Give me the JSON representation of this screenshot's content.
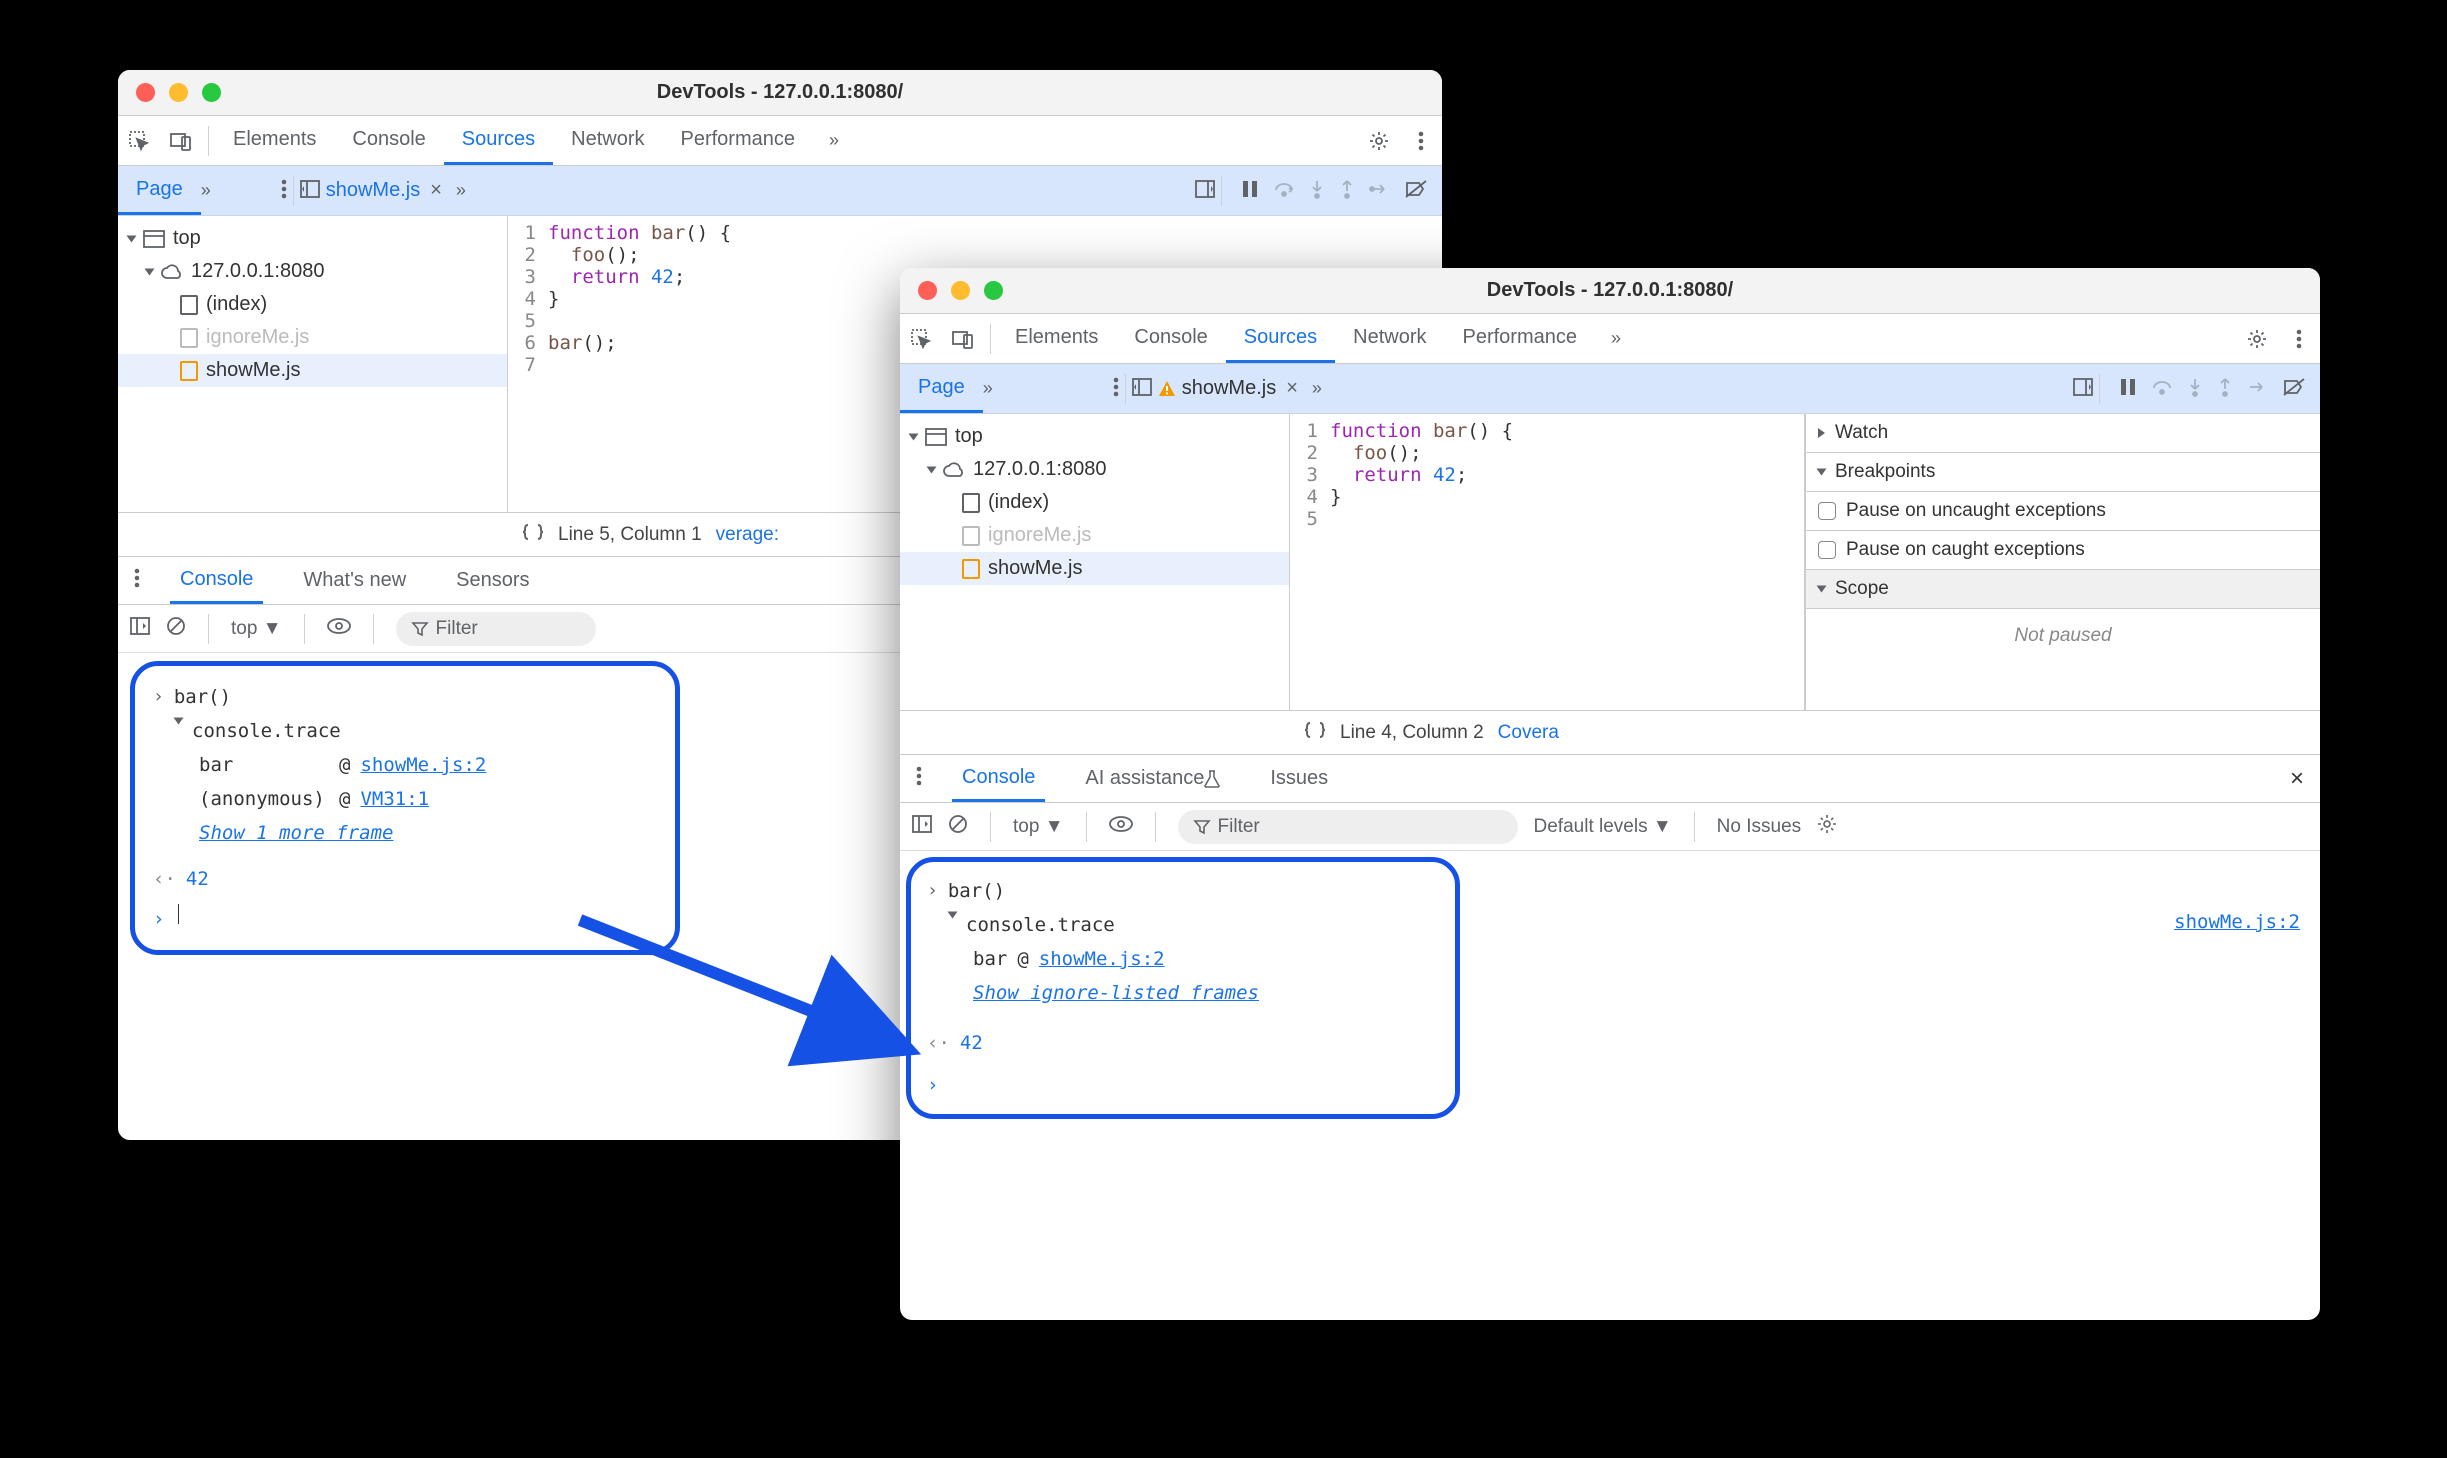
{
  "window1": {
    "title": "DevTools - 127.0.0.1:8080/",
    "mainTabs": [
      "Elements",
      "Console",
      "Sources",
      "Network",
      "Performance"
    ],
    "activeTab": "Sources",
    "page": {
      "tab": "Page",
      "openFile": "showMe.js"
    },
    "tree": {
      "top": "top",
      "host": "127.0.0.1:8080",
      "files": [
        "(index)",
        "ignoreMe.js",
        "showMe.js"
      ]
    },
    "code": [
      {
        "n": "1",
        "t": "function bar() {"
      },
      {
        "n": "2",
        "t": "  foo();"
      },
      {
        "n": "3",
        "t": "  return 42;"
      },
      {
        "n": "4",
        "t": "}"
      },
      {
        "n": "5",
        "t": ""
      },
      {
        "n": "6",
        "t": "bar();"
      },
      {
        "n": "7",
        "t": ""
      }
    ],
    "status": {
      "pos": "Line 5, Column 1",
      "extra": "verage:"
    },
    "drawer": {
      "tabs": [
        "Console",
        "What's new",
        "Sensors"
      ],
      "active": "Console",
      "context": "top",
      "filter": "Filter"
    },
    "console": {
      "call": "bar()",
      "trace": "console.trace",
      "rows": [
        {
          "fn": "bar",
          "sep": "@",
          "loc": "showMe.js:2"
        },
        {
          "fn": "(anonymous)",
          "sep": "@",
          "loc": "VM31:1"
        }
      ],
      "more": "Show 1 more frame",
      "ret": "42"
    }
  },
  "window2": {
    "title": "DevTools - 127.0.0.1:8080/",
    "mainTabs": [
      "Elements",
      "Console",
      "Sources",
      "Network",
      "Performance"
    ],
    "activeTab": "Sources",
    "page": {
      "tab": "Page",
      "openFile": "showMe.js"
    },
    "tree": {
      "top": "top",
      "host": "127.0.0.1:8080",
      "files": [
        "(index)",
        "ignoreMe.js",
        "showMe.js"
      ]
    },
    "code": [
      {
        "n": "1",
        "t": "function bar() {"
      },
      {
        "n": "2",
        "t": "  foo();"
      },
      {
        "n": "3",
        "t": "  return 42;"
      },
      {
        "n": "4",
        "t": "}"
      },
      {
        "n": "5",
        "t": ""
      }
    ],
    "status": {
      "pos": "Line 4, Column 2",
      "extra": "Covera"
    },
    "right": {
      "watch": "Watch",
      "bp": "Breakpoints",
      "p1": "Pause on uncaught exceptions",
      "p2": "Pause on caught exceptions",
      "scope": "Scope",
      "notPaused": "Not paused"
    },
    "drawer": {
      "tabs": [
        "Console",
        "AI assistance",
        "Issues"
      ],
      "active": "Console",
      "context": "top",
      "filter": "Filter",
      "levels": "Default levels",
      "issues": "No Issues"
    },
    "console": {
      "call": "bar()",
      "trace": "console.trace",
      "traceLoc": "showMe.js:2",
      "rows": [
        {
          "fn": "bar",
          "sep": "@",
          "loc": "showMe.js:2"
        }
      ],
      "more": "Show ignore-listed frames",
      "ret": "42"
    }
  }
}
